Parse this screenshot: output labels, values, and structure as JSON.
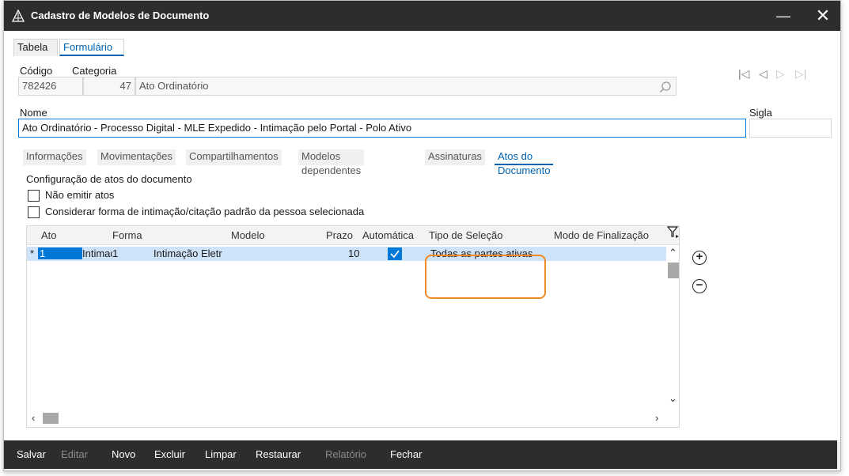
{
  "window": {
    "title": "Cadastro de Modelos de Documento",
    "minimize_glyph": "—",
    "close_glyph": "✕"
  },
  "top_tabs": [
    {
      "label": "Tabela",
      "active": false
    },
    {
      "label": "Formulário",
      "active": true
    }
  ],
  "form": {
    "codigo_label": "Código",
    "codigo_value": "782426",
    "categoria_label": "Categoria",
    "categoria_code": "47",
    "categoria_name": "Ato Ordinatório",
    "nome_label": "Nome",
    "nome_value": "Ato Ordinatório - Processo Digital - MLE Expedido - Intimação pelo Portal - Polo Ativo",
    "sigla_label": "Sigla",
    "sigla_value": ""
  },
  "record_nav": {
    "first": "|◁",
    "prev": "◁",
    "next": "▷",
    "last": "▷|"
  },
  "sub_tabs": [
    {
      "label": "Informações",
      "active": false
    },
    {
      "label": "Movimentações",
      "active": false
    },
    {
      "label": "Compartilhamentos",
      "active": false
    },
    {
      "label": "Modelos dependentes",
      "active": false
    },
    {
      "label": "Assinaturas",
      "active": false
    },
    {
      "label": "Atos do Documento",
      "active": true
    }
  ],
  "atos": {
    "section_label": "Configuração de atos do documento",
    "option_nao_emitir": "Não emitir atos",
    "option_considerar": "Considerar forma de intimação/citação padrão da pessoa selecionada",
    "columns": [
      "Ato",
      "Forma",
      "Modelo",
      "Prazo",
      "Automática",
      "Tipo de Seleção",
      "Modo de Finalização"
    ],
    "rows": [
      {
        "marker": "*",
        "ato": "1",
        "forma_code": "Intimação",
        "forma_num": "1",
        "modelo": "Intimação Eletr",
        "prazo": "10",
        "automatica": true,
        "tipo_selecao": "Todas as partes ativas",
        "modo_finalizacao": ""
      }
    ]
  },
  "bottom_bar": [
    {
      "label": "Salvar",
      "enabled": true
    },
    {
      "label": "Editar",
      "enabled": false
    },
    {
      "label": "Novo",
      "enabled": true
    },
    {
      "label": "Excluir",
      "enabled": true
    },
    {
      "label": "Limpar",
      "enabled": true
    },
    {
      "label": "Restaurar",
      "enabled": true
    },
    {
      "label": "Relatório",
      "enabled": false
    },
    {
      "label": "Fechar",
      "enabled": true
    }
  ],
  "colors": {
    "titlebar": "#2d2d2d",
    "accent": "#0078d7",
    "selected_row": "#cfe3f8",
    "highlight": "#f08a24"
  }
}
